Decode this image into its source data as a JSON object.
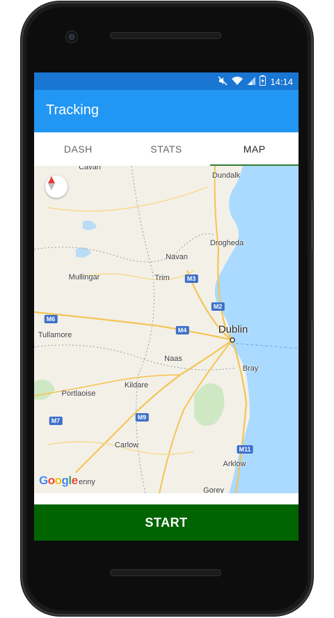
{
  "status_bar": {
    "time": "14:14",
    "icons": [
      "mute-icon",
      "wifi-icon",
      "signal-icon",
      "battery-icon"
    ]
  },
  "app_bar": {
    "title": "Tracking"
  },
  "tabs": [
    {
      "label": "DASH",
      "active": false
    },
    {
      "label": "STATS",
      "active": false
    },
    {
      "label": "MAP",
      "active": true
    }
  ],
  "map": {
    "towns": {
      "cavan": "Cavan",
      "dundalk": "Dundalk",
      "drogheda": "Drogheda",
      "navan": "Navan",
      "mullingar": "Mullingar",
      "trim": "Trim",
      "dublin": "Dublin",
      "tullamore": "Tullamore",
      "naas": "Naas",
      "bray": "Bray",
      "kildare": "Kildare",
      "portlaoise": "Portlaoise",
      "carlow": "Carlow",
      "arklow": "Arklow",
      "kilkenny": "enny",
      "gorey": "Gorey"
    },
    "roads": {
      "m3": "M3",
      "m2": "M2",
      "m6": "M6",
      "m4": "M4",
      "m7": "M7",
      "m9": "M9",
      "m11": "M11"
    },
    "attribution": "Google"
  },
  "actions": {
    "start_label": "START"
  },
  "colors": {
    "status_bar": "#1976d2",
    "app_bar": "#2196f3",
    "start_button": "#006400",
    "tab_indicator": "#2e7d32",
    "sea": "#aadaff"
  }
}
